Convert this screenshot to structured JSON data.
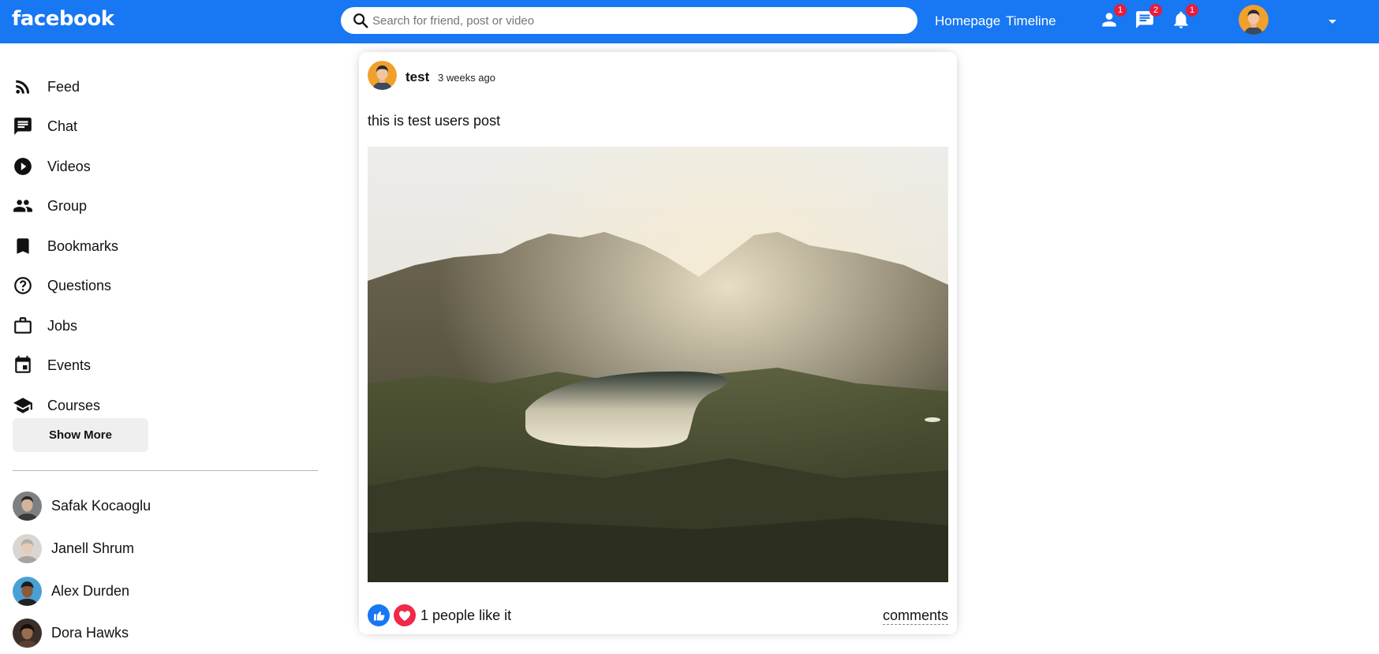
{
  "topbar": {
    "logo": "facebook",
    "search_placeholder": "Search for friend, post or video",
    "links": [
      "Homepage",
      "Timeline"
    ],
    "icons": [
      {
        "name": "person-icon",
        "badge": "1"
      },
      {
        "name": "chat-icon",
        "badge": "2"
      },
      {
        "name": "notifications-icon",
        "badge": "1"
      }
    ],
    "brand_color": "#1877f2",
    "badge_color": "#e41e3f"
  },
  "sidebar": {
    "items": [
      {
        "label": "Feed",
        "icon": "rss-feed-icon"
      },
      {
        "label": "Chat",
        "icon": "chat-icon"
      },
      {
        "label": "Videos",
        "icon": "play-circle-icon"
      },
      {
        "label": "Group",
        "icon": "group-icon"
      },
      {
        "label": "Bookmarks",
        "icon": "bookmark-icon"
      },
      {
        "label": "Questions",
        "icon": "help-outline-icon"
      },
      {
        "label": "Jobs",
        "icon": "work-outline-icon"
      },
      {
        "label": "Events",
        "icon": "event-icon"
      },
      {
        "label": "Courses",
        "icon": "school-icon"
      }
    ],
    "show_more": "Show More",
    "friends": [
      {
        "name": "Safak Kocaoglu"
      },
      {
        "name": "Janell Shrum"
      },
      {
        "name": "Alex Durden"
      },
      {
        "name": "Dora Hawks"
      }
    ]
  },
  "post": {
    "username": "test",
    "time": "3 weeks ago",
    "text": "this is test users post",
    "image": "mountain-lake-landscape",
    "likes": "1 people like it",
    "comments": "comments"
  }
}
